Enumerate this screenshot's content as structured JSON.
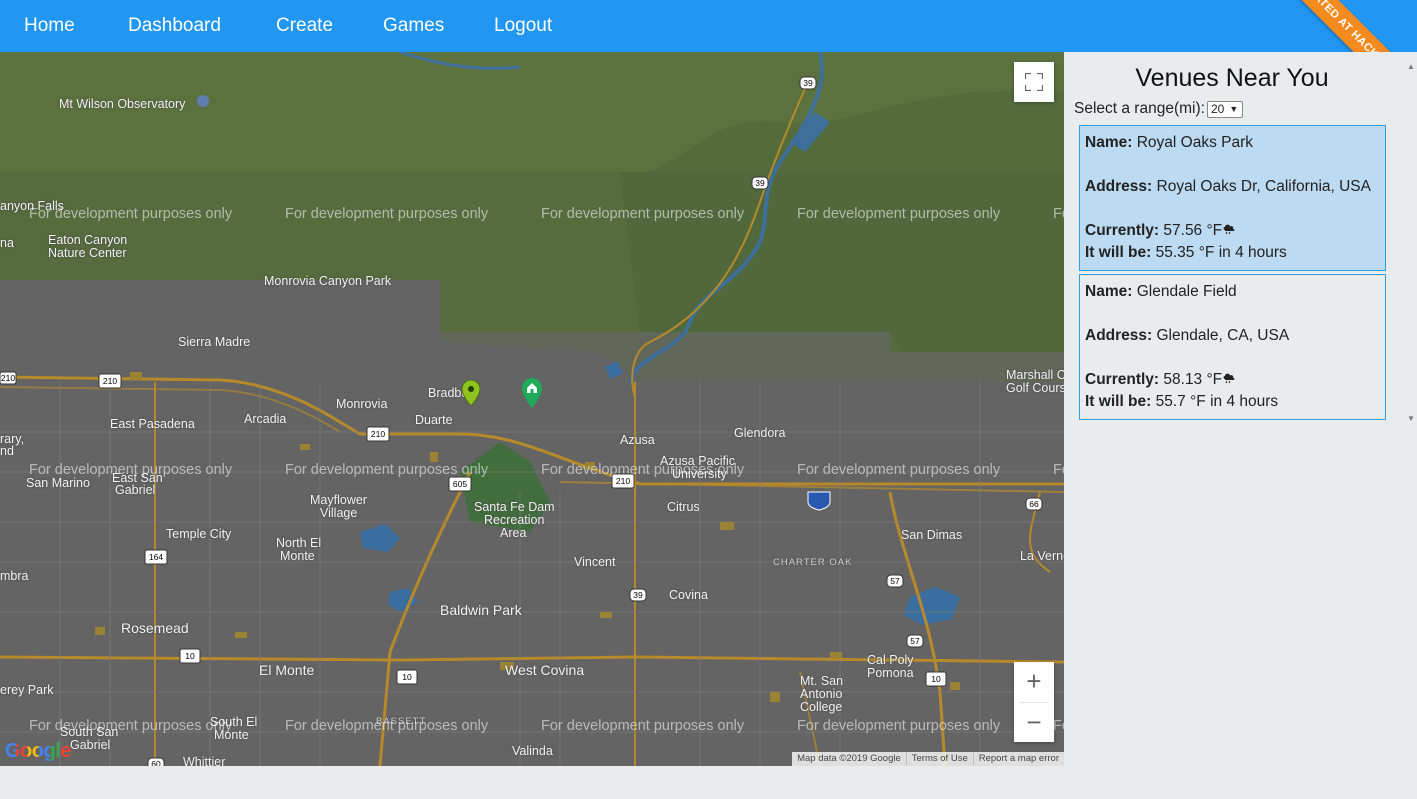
{
  "nav": {
    "links": [
      "Home",
      "Dashboard",
      "Create",
      "Games",
      "Logout"
    ],
    "ribbon": "Created at Hack Reactor"
  },
  "map": {
    "watermark": "For development purposes only",
    "places": {
      "mt_wilson": "Mt Wilson Observatory",
      "nyon_falls": "anyon Falls",
      "na": "na",
      "eaton_canyon": "Eaton Canyon",
      "nature_center": "Nature Center",
      "monrovia_canyon": "Monrovia Canyon Park",
      "sierra_madre": "Sierra Madre",
      "monrovia": "Monrovia",
      "bradbury": "Bradbury",
      "duarte": "Duarte",
      "arcadia": "Arcadia",
      "east_pasadena": "East Pasadena",
      "azusa": "Azusa",
      "glendora": "Glendora",
      "azusa_pacific": "Azusa Pacific",
      "university": "University",
      "marshall_canyon": "Marshall Canyo",
      "golf_course": "Golf Course",
      "rary": "rary,",
      "nd": "nd",
      "san_marino": "San Marino",
      "east_san_gabriel": "East San",
      "gabriel": "Gabriel",
      "mayflower": "Mayflower",
      "village": "Village",
      "santa_fe_dam": "Santa Fe Dam",
      "recreation": "Recreation",
      "area": "Area",
      "citrus": "Citrus",
      "temple_city": "Temple City",
      "north_el_monte": "North El",
      "monte": "Monte",
      "san_dimas": "San Dimas",
      "la_verne": "La Verne",
      "mbra": "mbra",
      "vincent": "Vincent",
      "charter_oak": "CHARTER OAK",
      "covina": "Covina",
      "baldwin_park": "Baldwin Park",
      "rosemead": "Rosemead",
      "el_monte": "El Monte",
      "west_covina": "West Covina",
      "cal_poly": "Cal Poly",
      "pomona": "Pomona",
      "erey_park": "erey Park",
      "mt_san_antonio": "Mt. San",
      "antonio": "Antonio",
      "college": "College",
      "south_el_monte": "South El",
      "monte2": "Monte",
      "south_san": "South San",
      "gabriel2": "Gabriel",
      "bassett": "BASSETT",
      "valinda": "Valinda",
      "whittier": "Whittier"
    },
    "highway_shields": [
      "39",
      "39",
      "210",
      "210",
      "210",
      "210",
      "605",
      "164",
      "10",
      "10",
      "10",
      "39",
      "57",
      "57",
      "66",
      "60"
    ],
    "google_logo": "Google",
    "attribution": [
      "Map data ©2019 Google",
      "Terms of Use",
      "Report a map error"
    ],
    "zoom_in": "+",
    "zoom_out": "−"
  },
  "panel": {
    "title": "Venues Near You",
    "range_label": "Select a range(mi):",
    "range_value": "20",
    "venues": [
      {
        "name_label": "Name:",
        "name": "Royal Oaks Park",
        "address_label": "Address:",
        "address": "Royal Oaks Dr, California, USA",
        "current_label": "Currently:",
        "current": "57.56 °F",
        "forecast_label": "It will be:",
        "forecast": "55.35 °F in 4 hours",
        "weather_icon": "rain-cloud-icon"
      },
      {
        "name_label": "Name:",
        "name": "Glendale Field",
        "address_label": "Address:",
        "address": "Glendale, CA, USA",
        "current_label": "Currently:",
        "current": "58.13 °F",
        "forecast_label": "It will be:",
        "forecast": "55.7 °F in 4 hours",
        "weather_icon": "rain-cloud-icon"
      }
    ]
  },
  "colors": {
    "navbar": "#2196f3",
    "ribbon": "#f58a1f",
    "selected_venue": "#bcdaf1",
    "venue_border": "#2d9fe3"
  }
}
